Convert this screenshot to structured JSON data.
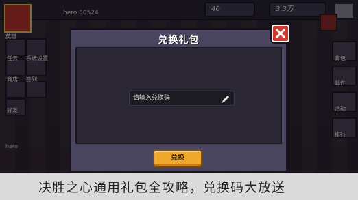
{
  "background": {
    "player_name": "hero 60524",
    "stat_a": "40",
    "stat_b": "3.3万",
    "left_labels": [
      "英雄",
      "任务",
      "系统设置",
      "商店",
      "签到",
      "好友"
    ],
    "right_labels": [
      "背包",
      "邮件",
      "活动",
      "排行"
    ],
    "hero_text": "hero"
  },
  "dialog": {
    "title": "兑换礼包",
    "input_placeholder": "请输入兑换码",
    "confirm_label": "兑换"
  },
  "caption": {
    "text": "决胜之心通用礼包全攻略，兑换码大放送"
  },
  "colors": {
    "dialog_bg": "#4a4660",
    "close_red": "#cf3a33",
    "button_orange": "#f0a82c"
  },
  "icons": {
    "close": "close-icon",
    "edit": "pencil-icon"
  }
}
